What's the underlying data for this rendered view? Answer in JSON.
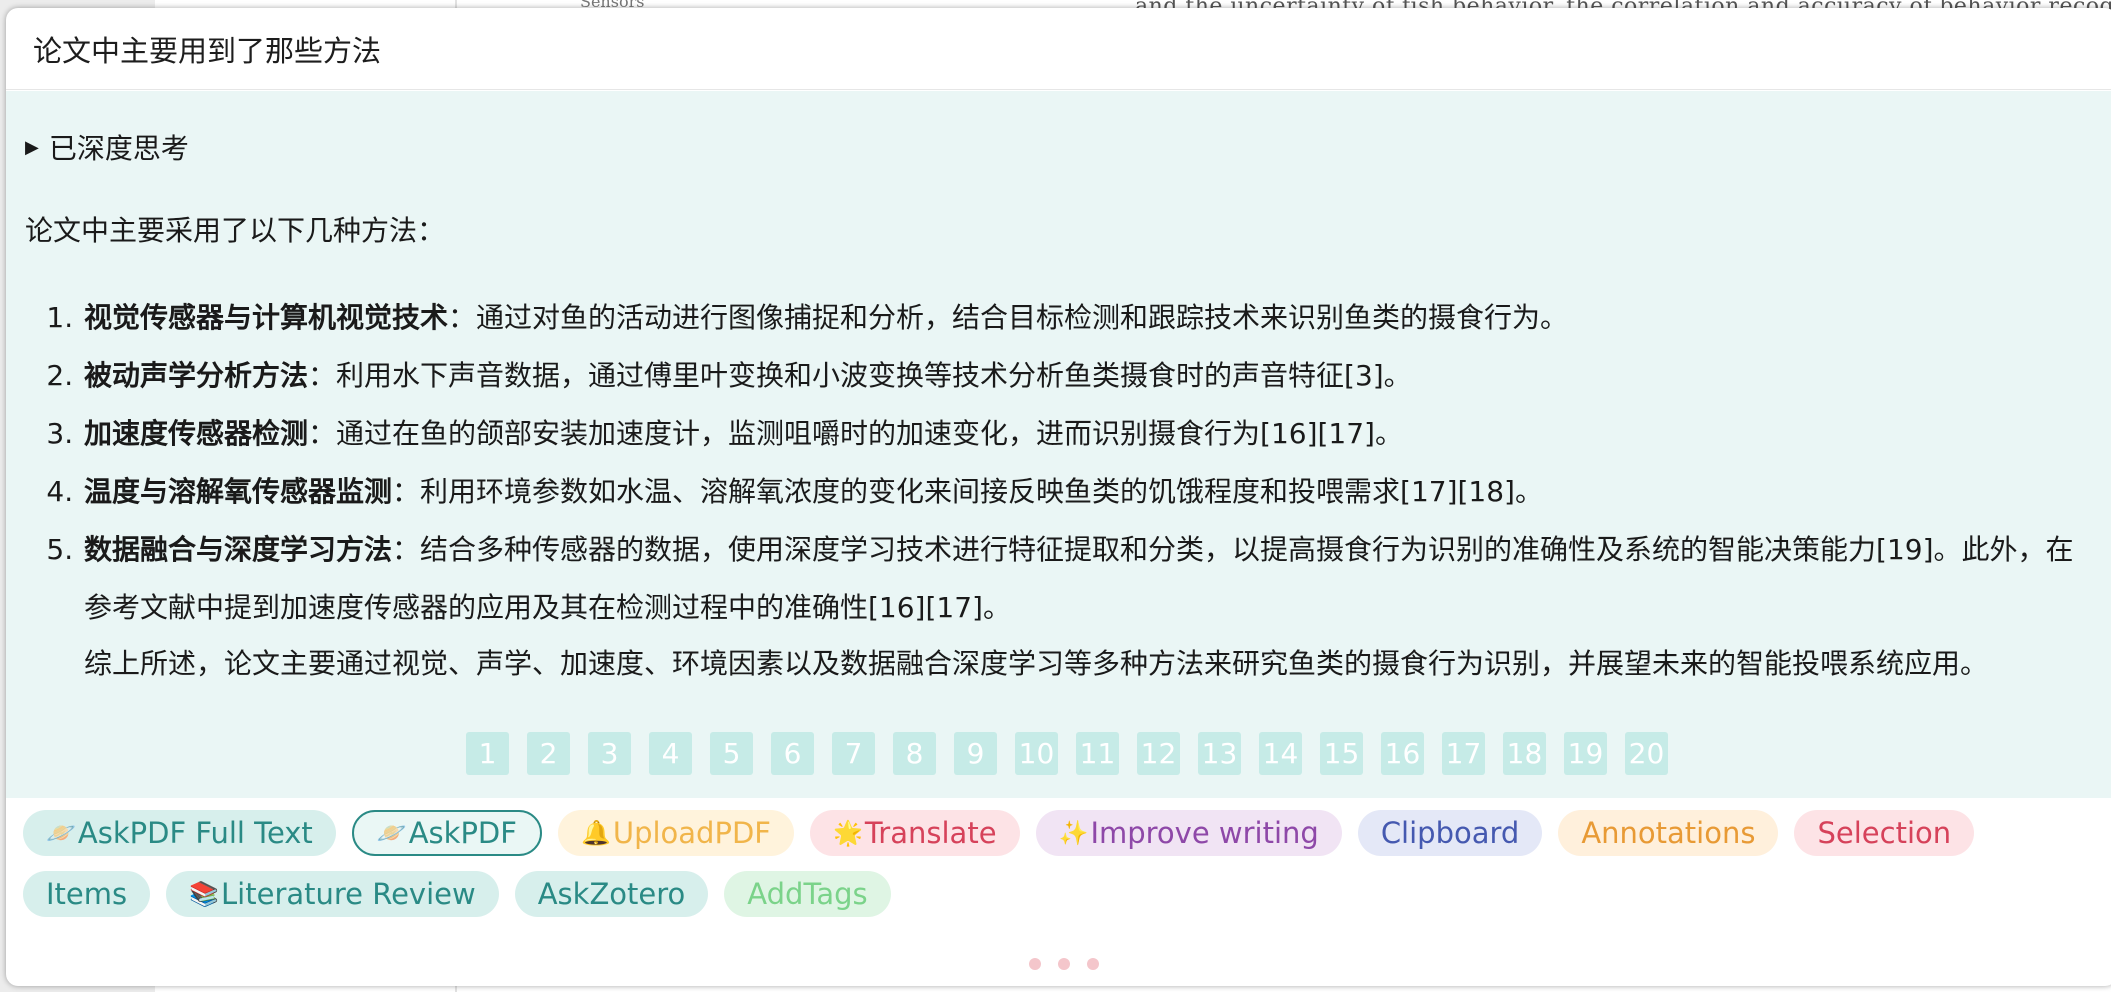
{
  "background": {
    "top_text": "and the uncertainty of fish behavior, the correlation and accuracy of behavior recognition are",
    "sensors_text": "Sensors"
  },
  "panel": {
    "question": "论文中主要用到了那些方法",
    "think_label": "已深度思考",
    "intro": "论文中主要采用了以下几种方法：",
    "methods": [
      {
        "title": "视觉传感器与计算机视觉技术",
        "text": "：通过对鱼的活动进行图像捕捉和分析，结合目标检测和跟踪技术来识别鱼类的摄食行为。"
      },
      {
        "title": "被动声学分析方法",
        "text": "：利用水下声音数据，通过傅里叶变换和小波变换等技术分析鱼类摄食时的声音特征[3]。"
      },
      {
        "title": "加速度传感器检测",
        "text": "：通过在鱼的颌部安装加速度计，监测咀嚼时的加速变化，进而识别摄食行为[16][17]。"
      },
      {
        "title": "温度与溶解氧传感器监测",
        "text": "：利用环境参数如水温、溶解氧浓度的变化来间接反映鱼类的饥饿程度和投喂需求[17][18]。"
      },
      {
        "title": "数据融合与深度学习方法",
        "text": "：结合多种传感器的数据，使用深度学习技术进行特征提取和分类，以提高摄食行为识别的准确性及系统的智能决策能力[19]。此外，在参考文献中提到加速度传感器的应用及其在检测过程中的准确性[16][17]。"
      }
    ],
    "summary": "综上所述，论文主要通过视觉、声学、加速度、环境因素以及数据融合深度学习等多种方法来研究鱼类的摄食行为识别，并展望未来的智能投喂系统应用。",
    "pages": [
      "1",
      "2",
      "3",
      "4",
      "5",
      "6",
      "7",
      "8",
      "9",
      "10",
      "11",
      "12",
      "13",
      "14",
      "15",
      "16",
      "17",
      "18",
      "19",
      "20"
    ]
  },
  "chips": {
    "askpdf_full": "AskPDF Full Text",
    "askpdf": "AskPDF",
    "uploadpdf": "UploadPDF",
    "translate": "Translate",
    "improve": "Improve writing",
    "clipboard": "Clipboard",
    "annotations": "Annotations",
    "selection": "Selection",
    "items": "Items",
    "litreview": "Literature Review",
    "askzotero": "AskZotero",
    "addtags": "AddTags"
  },
  "icons": {
    "askpdf_full": "🪐",
    "askpdf": "🪐",
    "uploadpdf": "🔔",
    "translate": "🌟",
    "improve": "✨",
    "litreview": "📚"
  },
  "colors": {
    "answer_bg": "#eaf6f5",
    "accent_teal": "#2a8a85",
    "page_chip": "#c6ebe7"
  }
}
